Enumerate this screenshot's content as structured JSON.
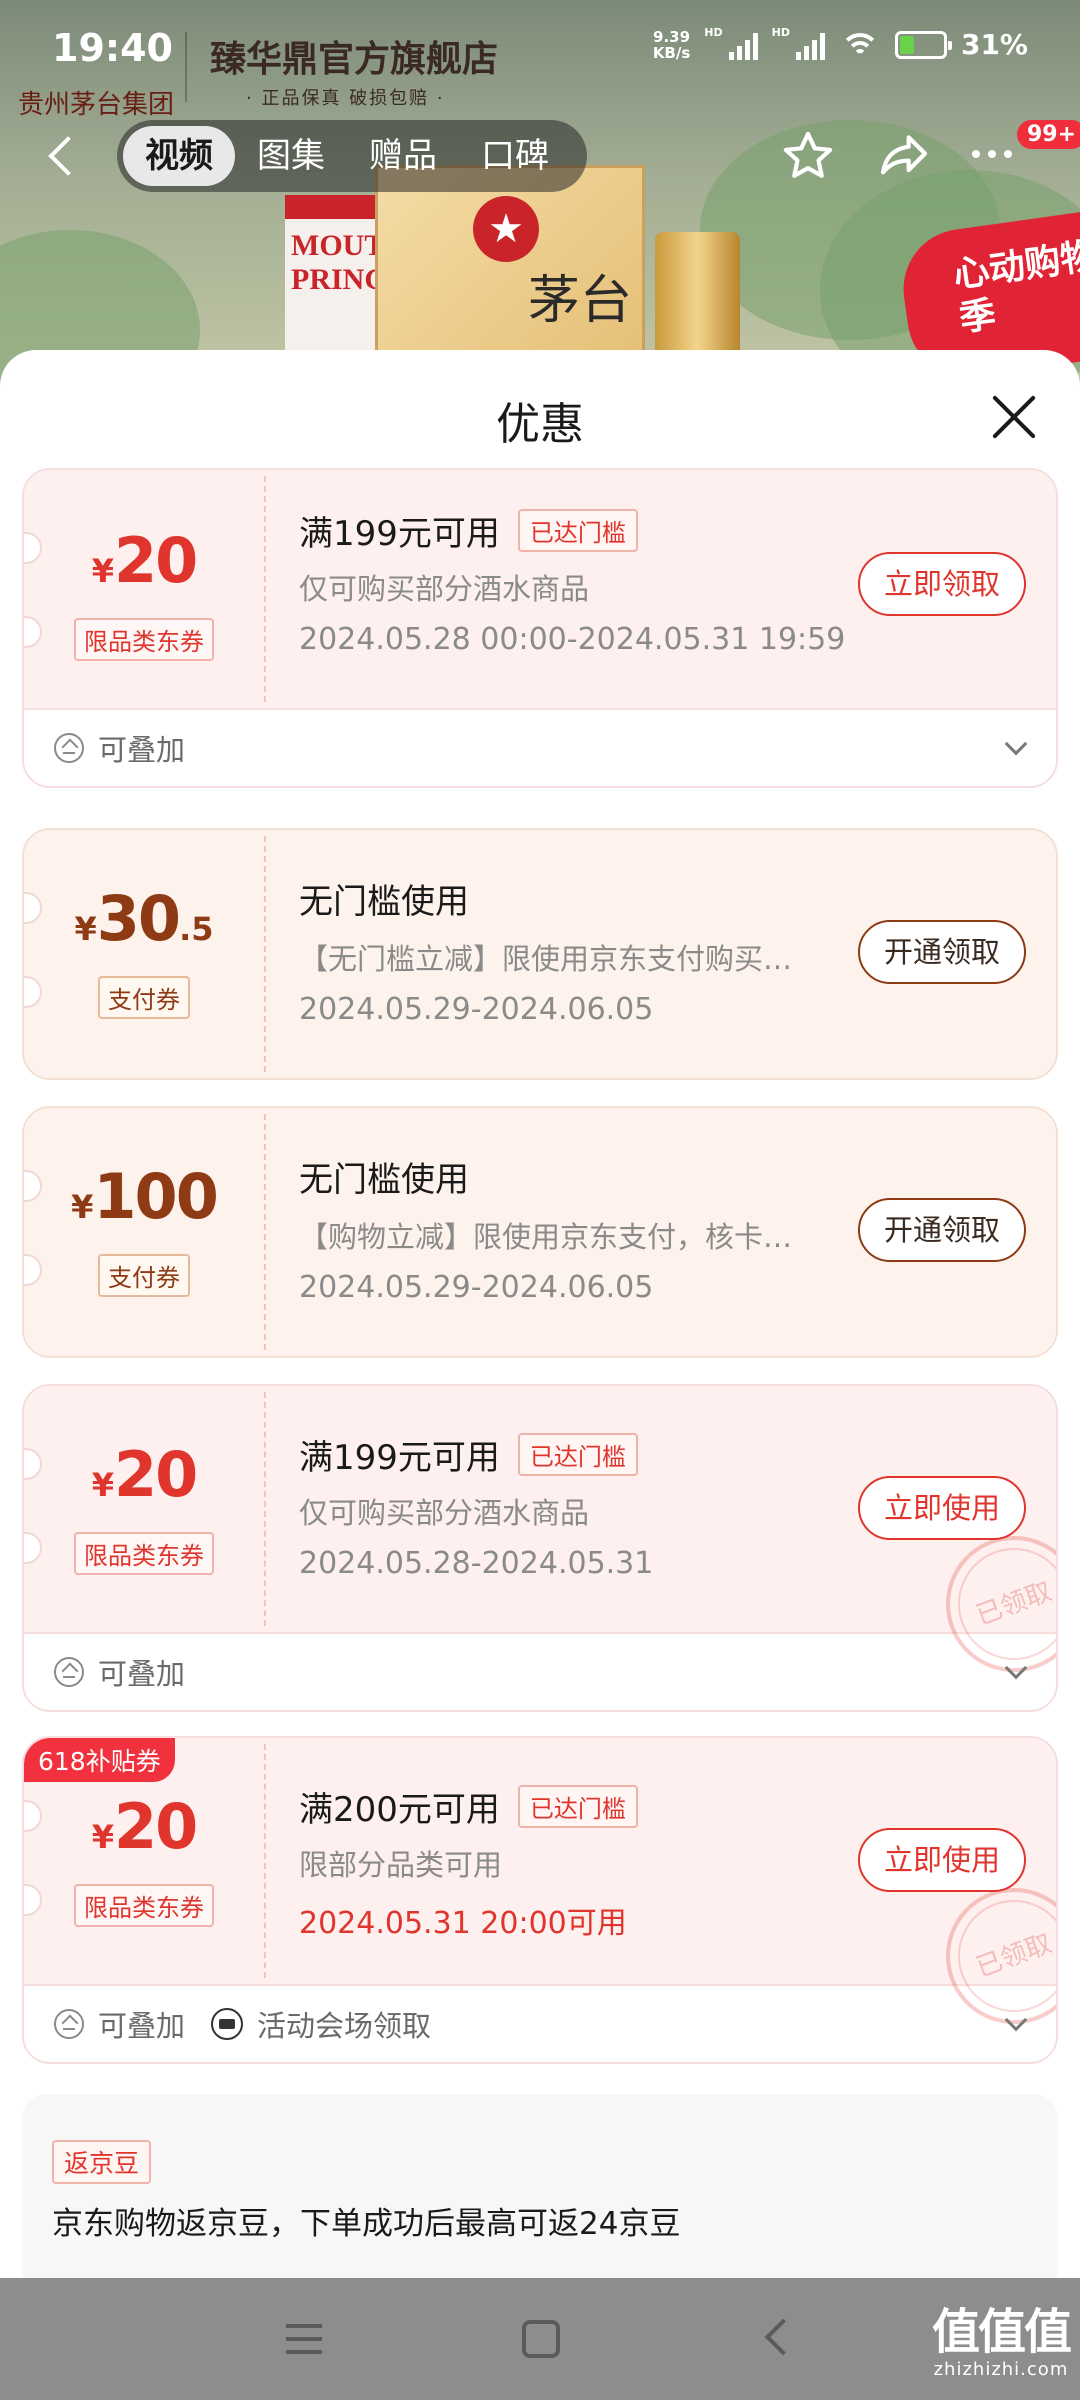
{
  "status_bar": {
    "time": "19:40",
    "net_speed_value": "9.39",
    "net_speed_unit": "KB/s",
    "hd1": "HD",
    "hd2": "HD",
    "battery_level": 0.31,
    "battery": "31%"
  },
  "store": {
    "name": "臻华鼎官方旗舰店",
    "tagline": "· 正品保真 破损包赔 ·",
    "logo_text": "贵州茅台集团"
  },
  "nav": {
    "tabs": [
      {
        "label": "视频",
        "active": true
      },
      {
        "label": "图集"
      },
      {
        "label": "赠品"
      },
      {
        "label": "口碑"
      }
    ],
    "cart_badge": "99+"
  },
  "banner": {
    "product_label": "MOUTAI PRINCE",
    "brand_char": "茅台",
    "promo": "心动购物季"
  },
  "sheet": {
    "title": "优惠"
  },
  "coupons": [
    {
      "currency": "¥",
      "amount": "20",
      "amount_decimal": "",
      "type": "限品类东券",
      "title": "满199元可用",
      "tag": "已达门槛",
      "desc": "仅可购买部分酒水商品",
      "date": "2024.05.28 00:00-2024.05.31 19:59",
      "button": "立即领取",
      "feature_stackable": "可叠加"
    },
    {
      "currency": "¥",
      "amount": "30",
      "amount_decimal": ".5",
      "type": "支付券",
      "title": "无门槛使用",
      "desc": "【无门槛立减】限使用京东支付购买…",
      "date": "2024.05.29-2024.06.05",
      "button": "开通领取"
    },
    {
      "currency": "¥",
      "amount": "100",
      "amount_decimal": "",
      "type": "支付券",
      "title": "无门槛使用",
      "desc": "【购物立减】限使用京东支付，核卡…",
      "date": "2024.05.29-2024.06.05",
      "button": "开通领取"
    },
    {
      "currency": "¥",
      "amount": "20",
      "amount_decimal": "",
      "type": "限品类东券",
      "title": "满199元可用",
      "tag": "已达门槛",
      "desc": "仅可购买部分酒水商品",
      "date": "2024.05.28-2024.05.31",
      "button": "立即使用",
      "stamp": "已领取",
      "feature_stackable": "可叠加"
    },
    {
      "corner_tag": "618补贴券",
      "currency": "¥",
      "amount": "20",
      "amount_decimal": "",
      "type": "限品类东券",
      "title": "满200元可用",
      "tag": "已达门槛",
      "desc": "限部分品类可用",
      "date": "2024.05.31 20:00可用",
      "button": "立即使用",
      "stamp": "已领取",
      "feature_stackable": "可叠加",
      "feature_venue": "活动会场领取"
    }
  ],
  "bean": {
    "tag": "返京豆",
    "text": "京东购物返京豆，下单成功后最高可返24京豆"
  },
  "watermark": {
    "main": "值值值",
    "sub": "zhizhizhi.com"
  },
  "colors": {
    "accent_red": "#e0352d",
    "pay_brown": "#8e3a14",
    "coupon_bg": "#fdf0ee"
  }
}
